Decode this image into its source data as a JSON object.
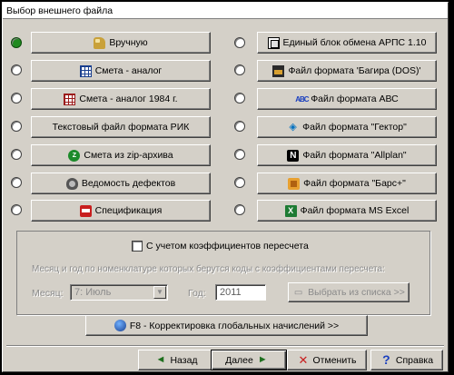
{
  "window": {
    "title": "Выбор внешнего файла"
  },
  "left_options": [
    {
      "label": "Вручную",
      "icon": "hand-icon",
      "checked": true
    },
    {
      "label": "Смета - аналог",
      "icon": "estimate-icon",
      "checked": false
    },
    {
      "label": "Смета - аналог 1984 г.",
      "icon": "estimate-1984-icon",
      "checked": false
    },
    {
      "label": "Текстовый файл формата РИК",
      "icon": "",
      "checked": false
    },
    {
      "label": "Смета из zip-архива",
      "icon": "zip-icon",
      "checked": false
    },
    {
      "label": "Ведомость дефектов",
      "icon": "defect-icon",
      "checked": false
    },
    {
      "label": "Спецификация",
      "icon": "specification-icon",
      "checked": false
    }
  ],
  "right_options": [
    {
      "label": "Единый блок обмена АРПС 1.10",
      "icon": "block-icon",
      "checked": false
    },
    {
      "label": "Файл формата 'Багира (DOS)'",
      "icon": "bagira-icon",
      "checked": false
    },
    {
      "label": "Файл формата АВС",
      "icon": "abc-icon",
      "checked": false
    },
    {
      "label": "Файл формата \"Гектор\"",
      "icon": "gektor-icon",
      "checked": false
    },
    {
      "label": "Файл формата \"Allplan\"",
      "icon": "allplan-icon",
      "checked": false
    },
    {
      "label": "Файл формата \"Барс+\"",
      "icon": "bars-icon",
      "checked": false
    },
    {
      "label": "Файл формата MS Excel",
      "icon": "excel-icon",
      "checked": false
    }
  ],
  "recalc": {
    "checkbox_label": "С учетом коэффициентов пересчета",
    "checked": false,
    "hint": "Месяц и год по номенклатуре которых берутся коды с коэффициентами пересчета:",
    "month_label": "Месяц:",
    "month_value": "7: Июль",
    "year_label": "Год:",
    "year_value": "2011",
    "pick_button": "Выбрать из списка >>"
  },
  "globals_button": "F8 - Корректировка глобальных начислений >>",
  "footer": {
    "back": "Назад",
    "next": "Далее",
    "cancel": "Отменить",
    "help": "Справка"
  },
  "colors": {
    "window_bg": "#d4d0c8",
    "radio_checked": "#1f8a1f"
  }
}
